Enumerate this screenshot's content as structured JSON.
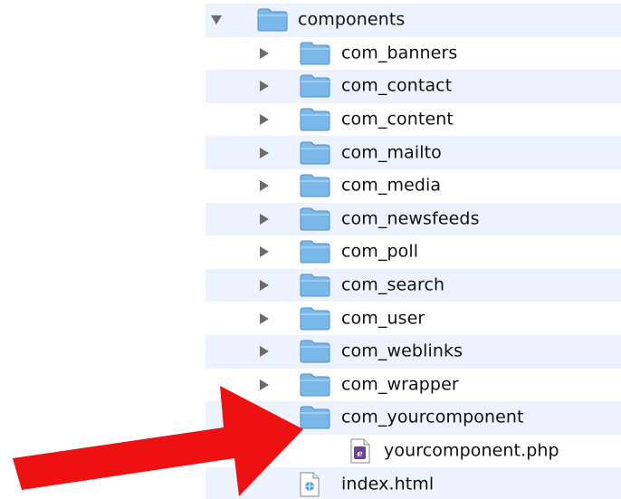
{
  "colors": {
    "row_alt_bg": "#edf3fe",
    "folder_blue": "#7ab8ea",
    "arrow_red": "#ee1111"
  },
  "tree": {
    "items": [
      {
        "label": "components",
        "type": "folder",
        "state": "expanded",
        "level": 0
      },
      {
        "label": "com_banners",
        "type": "folder",
        "state": "collapsed",
        "level": 1
      },
      {
        "label": "com_contact",
        "type": "folder",
        "state": "collapsed",
        "level": 1
      },
      {
        "label": "com_content",
        "type": "folder",
        "state": "collapsed",
        "level": 1
      },
      {
        "label": "com_mailto",
        "type": "folder",
        "state": "collapsed",
        "level": 1
      },
      {
        "label": "com_media",
        "type": "folder",
        "state": "collapsed",
        "level": 1
      },
      {
        "label": "com_newsfeeds",
        "type": "folder",
        "state": "collapsed",
        "level": 1
      },
      {
        "label": "com_poll",
        "type": "folder",
        "state": "collapsed",
        "level": 1
      },
      {
        "label": "com_search",
        "type": "folder",
        "state": "collapsed",
        "level": 1
      },
      {
        "label": "com_user",
        "type": "folder",
        "state": "collapsed",
        "level": 1
      },
      {
        "label": "com_weblinks",
        "type": "folder",
        "state": "collapsed",
        "level": 1
      },
      {
        "label": "com_wrapper",
        "type": "folder",
        "state": "collapsed",
        "level": 1
      },
      {
        "label": "com_yourcomponent",
        "type": "folder",
        "state": "expanded",
        "level": 1
      },
      {
        "label": "yourcomponent.php",
        "type": "php-file",
        "level": 2
      },
      {
        "label": "index.html",
        "type": "html-file",
        "level": 1
      }
    ]
  },
  "annotation": {
    "icon": "red-arrow-icon",
    "points_to": "com_yourcomponent"
  }
}
